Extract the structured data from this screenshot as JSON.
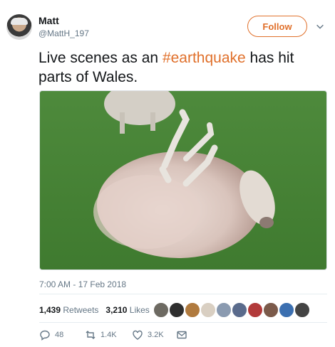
{
  "author": {
    "name": "Matt",
    "handle": "@MattH_197"
  },
  "follow_label": "Follow",
  "tweet": {
    "text_before": "Live scenes as an ",
    "hashtag": "#earthquake",
    "text_after": " has hit parts of Wales."
  },
  "timestamp": "7:00 AM - 17 Feb 2018",
  "stats": {
    "retweets_count": "1,439",
    "retweets_label": "Retweets",
    "likes_count": "3,210",
    "likes_label": "Likes"
  },
  "actions": {
    "replies": "48",
    "retweets": "1.4K",
    "likes": "3.2K"
  },
  "colors": {
    "accent": "#e0702b",
    "muted": "#657786"
  },
  "icons": {
    "more": "chevron-down-icon",
    "reply": "reply-icon",
    "retweet": "retweet-icon",
    "like": "heart-icon",
    "dm": "envelope-icon"
  }
}
